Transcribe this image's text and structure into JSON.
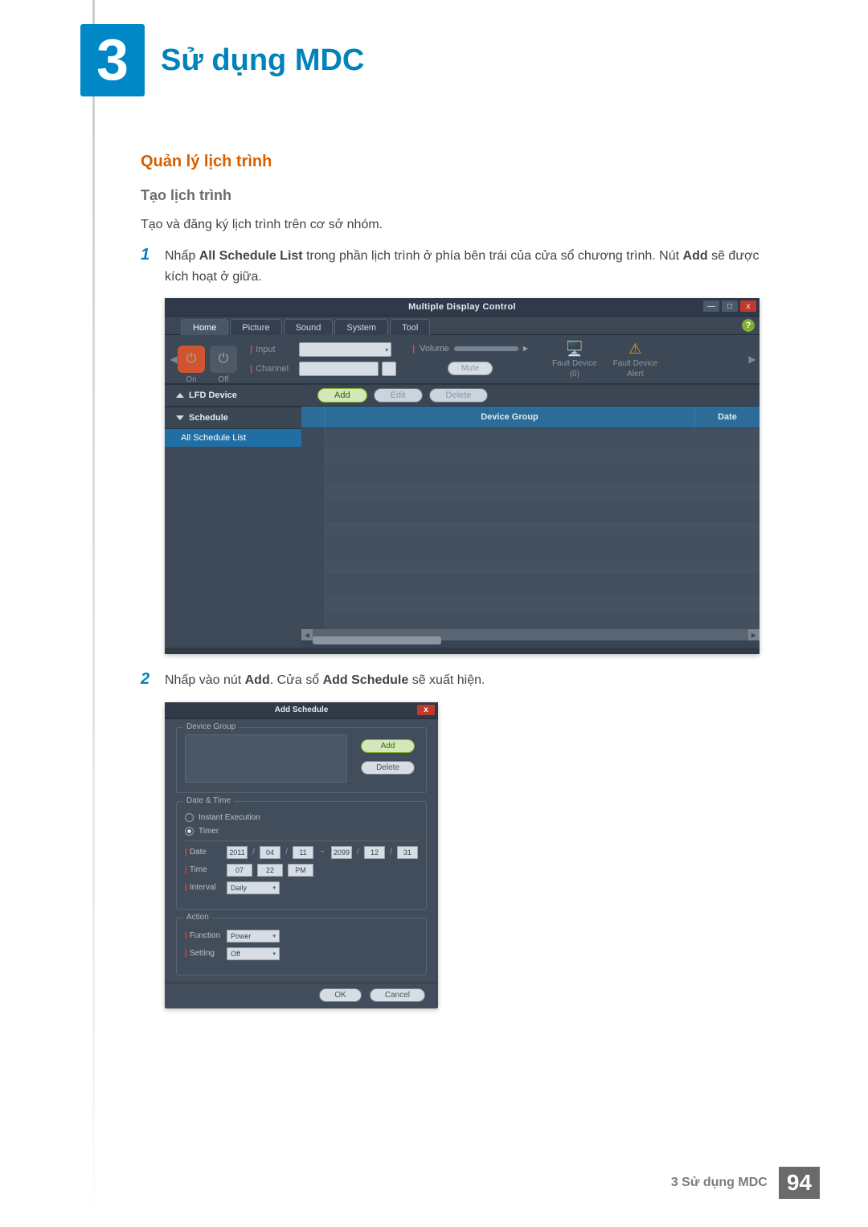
{
  "chapter_num": "3",
  "chapter_title": "Sử dụng MDC",
  "section_heading": "Quản lý lịch trình",
  "sub_heading": "Tạo lịch trình",
  "intro_text": "Tạo và đăng ký lịch trình trên cơ sở nhóm.",
  "step1_num": "1",
  "step1_a": "Nhấp ",
  "step1_b": "All Schedule List",
  "step1_c": " trong phần lịch trình ở phía bên trái của cửa sổ chương trình. Nút ",
  "step1_d": "Add",
  "step1_e": " sẽ được kích hoạt ở giữa.",
  "step2_num": "2",
  "step2_a": "Nhấp vào nút ",
  "step2_b": "Add",
  "step2_c": ". Cửa sổ ",
  "step2_d": "Add Schedule",
  "step2_e": " sẽ xuất hiện.",
  "mdc": {
    "title": "Multiple Display Control",
    "win_min": "—",
    "win_max": "□",
    "win_close": "x",
    "tabs": {
      "home": "Home",
      "picture": "Picture",
      "sound": "Sound",
      "system": "System",
      "tool": "Tool"
    },
    "help": "?",
    "power_on": "⏻",
    "power_off": "⏻",
    "cap_on": "On",
    "cap_off": "Off",
    "input_label": "Input",
    "channel_label": "Channel",
    "volume_label": "Volume",
    "mute_label": "Mute",
    "fault0_label": "Fault Device",
    "fault0_count": "(0)",
    "fault1_label": "Fault Device",
    "fault1_sub": "Alert",
    "sidebar_lfd": "LFD Device",
    "sidebar_schedule": "Schedule",
    "sidebar_all": "All Schedule List",
    "crud_add": "Add",
    "crud_edit": "Edit",
    "crud_delete": "Delete",
    "col_group": "Device Group",
    "col_date": "Date"
  },
  "dlg": {
    "title": "Add Schedule",
    "g_device": "Device Group",
    "btn_add": "Add",
    "btn_delete": "Delete",
    "g_datetime": "Date & Time",
    "r_instant": "Instant Execution",
    "r_timer": "Timer",
    "date_label": "Date",
    "date_y1": "2011",
    "date_m1": "04",
    "date_d1": "11",
    "date_sep": "/",
    "date_tilde": "~",
    "date_y2": "2099",
    "date_m2": "12",
    "date_d2": "31",
    "time_label": "Time",
    "time_h": "07",
    "time_m": "22",
    "time_ampm": "PM",
    "interval_label": "Interval",
    "interval_val": "Daily",
    "g_action": "Action",
    "func_label": "Function",
    "func_val": "Power",
    "setting_label": "Setting",
    "setting_val": "Off",
    "ok": "OK",
    "cancel": "Cancel"
  },
  "footer_text": "3 Sử dụng MDC",
  "page_number": "94"
}
